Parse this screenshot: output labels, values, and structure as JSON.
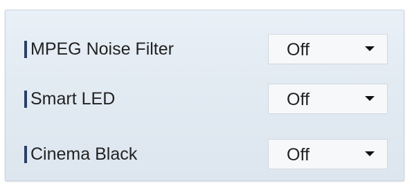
{
  "settings": [
    {
      "label": "MPEG Noise Filter",
      "value": "Off"
    },
    {
      "label": "Smart LED",
      "value": "Off"
    },
    {
      "label": "Cinema Black",
      "value": "Off"
    }
  ],
  "icons": {
    "dropdown": "chevron-down-icon",
    "row_marker": "bar-marker-icon"
  },
  "colors": {
    "panel_background": "#e2eaf2",
    "row_marker": "#2b3f66",
    "select_background": "#f6f8fa"
  }
}
